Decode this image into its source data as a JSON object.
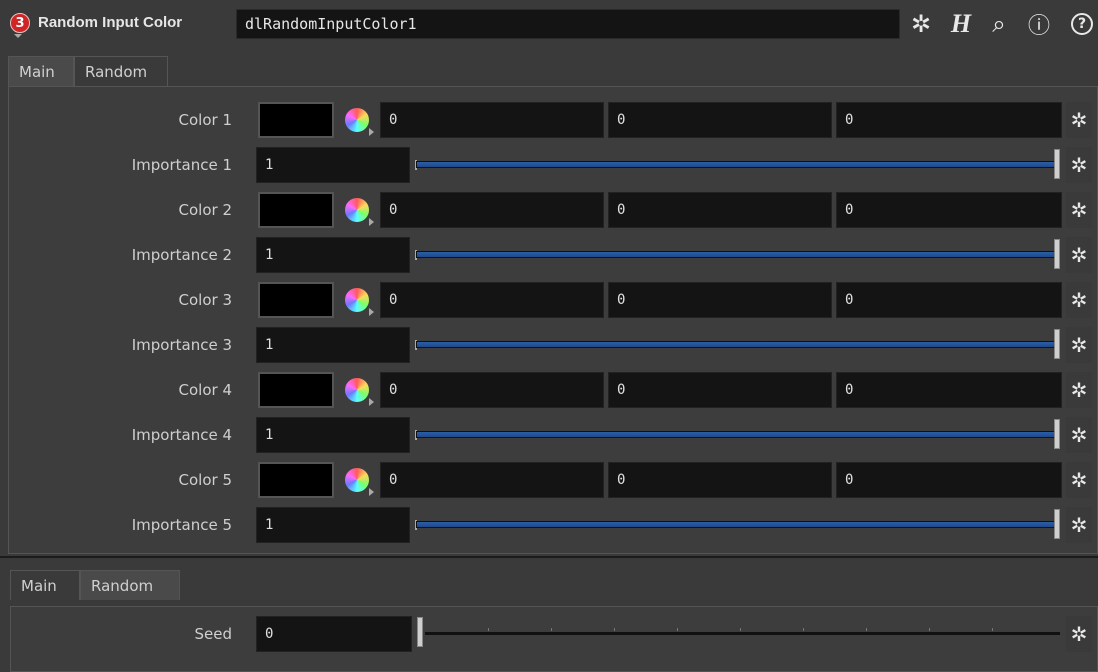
{
  "header": {
    "op_type": "Random Input Color",
    "node_name": "dlRandomInputColor1",
    "op_icon_glyph": "3",
    "icons": [
      "gear-menu-icon",
      "help-houdini-icon",
      "search-icon",
      "info-icon",
      "help-icon"
    ],
    "h_glyph": "H",
    "search_glyph": "⌕",
    "info_glyph": "ⓘ",
    "help_glyph": "?"
  },
  "tabs_top": [
    {
      "label": "Main",
      "active": false
    },
    {
      "label": "Random",
      "active": true
    }
  ],
  "rows": [
    {
      "kind": "color",
      "label": "Color 1",
      "values": [
        "0",
        "0",
        "0"
      ]
    },
    {
      "kind": "importance",
      "label": "Importance 1",
      "value": "1",
      "fraction": 1.0
    },
    {
      "kind": "color",
      "label": "Color 2",
      "values": [
        "0",
        "0",
        "0"
      ]
    },
    {
      "kind": "importance",
      "label": "Importance 2",
      "value": "1",
      "fraction": 1.0
    },
    {
      "kind": "color",
      "label": "Color 3",
      "values": [
        "0",
        "0",
        "0"
      ]
    },
    {
      "kind": "importance",
      "label": "Importance 3",
      "value": "1",
      "fraction": 1.0
    },
    {
      "kind": "color",
      "label": "Color 4",
      "values": [
        "0",
        "0",
        "0"
      ]
    },
    {
      "kind": "importance",
      "label": "Importance 4",
      "value": "1",
      "fraction": 1.0
    },
    {
      "kind": "color",
      "label": "Color 5",
      "values": [
        "0",
        "0",
        "0"
      ]
    },
    {
      "kind": "importance",
      "label": "Importance 5",
      "value": "1",
      "fraction": 1.0
    }
  ],
  "tabs_bottom": [
    {
      "label": "Main",
      "active": false
    },
    {
      "label": "Random",
      "active": true
    }
  ],
  "seed": {
    "label": "Seed",
    "value": "0",
    "fraction": 0.0
  },
  "colors": {
    "op_icon": "#d02525",
    "slider_fill": "#2a5fa8",
    "field_bg": "#141414",
    "panel_bg": "#3d3d3d"
  }
}
